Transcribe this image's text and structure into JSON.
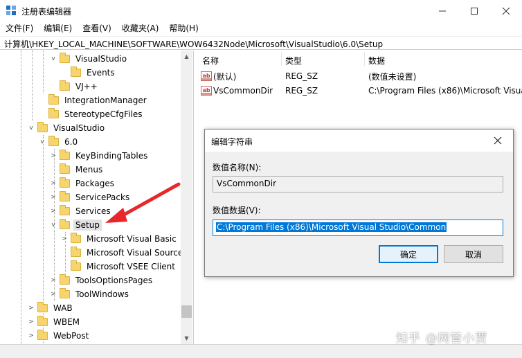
{
  "window": {
    "title": "注册表编辑器",
    "minimize_icon": "minimize-icon",
    "maximize_icon": "maximize-icon",
    "close_icon": "close-icon"
  },
  "menu": [
    "文件(F)",
    "编辑(E)",
    "查看(V)",
    "收藏夹(A)",
    "帮助(H)"
  ],
  "address": "计算机\\HKEY_LOCAL_MACHINE\\SOFTWARE\\WOW6432Node\\Microsoft\\VisualStudio\\6.0\\Setup",
  "tree": {
    "rows": [
      {
        "label": "VisualStudio",
        "toggle": "v",
        "level": 3
      },
      {
        "label": "Events",
        "toggle": "",
        "level": 4
      },
      {
        "label": "VJ++",
        "toggle": "",
        "level": 3
      },
      {
        "label": "IntegrationManager",
        "toggle": "",
        "level": 2
      },
      {
        "label": "StereotypeCfgFiles",
        "toggle": "",
        "level": 2
      },
      {
        "label": "VisualStudio",
        "toggle": "v",
        "level": 1
      },
      {
        "label": "6.0",
        "toggle": "v",
        "level": 2
      },
      {
        "label": "KeyBindingTables",
        "toggle": ">",
        "level": 3
      },
      {
        "label": "Menus",
        "toggle": "",
        "level": 3
      },
      {
        "label": "Packages",
        "toggle": ">",
        "level": 3
      },
      {
        "label": "ServicePacks",
        "toggle": ">",
        "level": 3
      },
      {
        "label": "Services",
        "toggle": ">",
        "level": 3
      },
      {
        "label": "Setup",
        "toggle": "v",
        "level": 3,
        "selected": true
      },
      {
        "label": "Microsoft Visual Basic",
        "toggle": ">",
        "level": 4
      },
      {
        "label": "Microsoft Visual Source",
        "toggle": "",
        "level": 4
      },
      {
        "label": "Microsoft VSEE Client",
        "toggle": "",
        "level": 4
      },
      {
        "label": "ToolsOptionsPages",
        "toggle": ">",
        "level": 3
      },
      {
        "label": "ToolWindows",
        "toggle": ">",
        "level": 3
      },
      {
        "label": "WAB",
        "toggle": ">",
        "level": 1
      },
      {
        "label": "WBEM",
        "toggle": ">",
        "level": 1
      },
      {
        "label": "WebPost",
        "toggle": ">",
        "level": 1
      }
    ]
  },
  "list": {
    "columns": [
      "名称",
      "类型",
      "数据"
    ],
    "rows": [
      {
        "name": "(默认)",
        "type": "REG_SZ",
        "data": "(数值未设置)"
      },
      {
        "name": "VsCommonDir",
        "type": "REG_SZ",
        "data": "C:\\Program Files (x86)\\Microsoft Visua"
      }
    ]
  },
  "dialog": {
    "title": "编辑字符串",
    "name_label": "数值名称(N):",
    "name_value": "VsCommonDir",
    "data_label": "数值数据(V):",
    "data_value": "C:\\Program Files (x86)\\Microsoft Visual Studio\\Common",
    "ok_label": "确定",
    "cancel_label": "取消"
  },
  "watermark": "知乎 @网管小贾",
  "colors": {
    "accent": "#0078d7",
    "arrow": "#e8262b",
    "folder": "#f6d56f"
  }
}
